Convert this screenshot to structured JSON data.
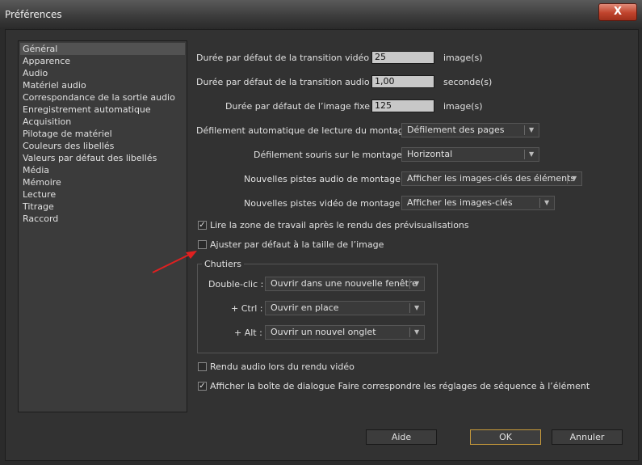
{
  "window": {
    "title": "Préférences",
    "close_label": "X"
  },
  "sidebar": {
    "items": [
      {
        "label": "Général",
        "selected": true
      },
      {
        "label": "Apparence"
      },
      {
        "label": "Audio"
      },
      {
        "label": "Matériel audio"
      },
      {
        "label": "Correspondance de la sortie audio"
      },
      {
        "label": "Enregistrement automatique"
      },
      {
        "label": "Acquisition"
      },
      {
        "label": "Pilotage de matériel"
      },
      {
        "label": "Couleurs des libellés"
      },
      {
        "label": "Valeurs par défaut des libellés"
      },
      {
        "label": "Média"
      },
      {
        "label": "Mémoire"
      },
      {
        "label": "Lecture"
      },
      {
        "label": "Titrage"
      },
      {
        "label": "Raccord"
      }
    ]
  },
  "fields": {
    "video_transition": {
      "label": "Durée par défaut de la transition vidéo :",
      "value": "25",
      "unit": "image(s)"
    },
    "audio_transition": {
      "label": "Durée par défaut de la transition audio :",
      "value": "1,00",
      "unit": "seconde(s)"
    },
    "still_image": {
      "label": "Durée par défaut de l’image fixe :",
      "value": "125",
      "unit": "image(s)"
    }
  },
  "dropdowns": {
    "auto_scroll": {
      "label": "Défilement automatique de lecture du montage :",
      "value": "Défilement des pages"
    },
    "mouse_scroll": {
      "label": "Défilement souris sur le montage :",
      "value": "Horizontal"
    },
    "new_audio_tracks": {
      "label": "Nouvelles pistes audio de montage :",
      "value": "Afficher les images-clés des éléments"
    },
    "new_video_tracks": {
      "label": "Nouvelles pistes vidéo de montage :",
      "value": "Afficher les images-clés"
    }
  },
  "checkboxes": {
    "play_work_area": {
      "label": "Lire la zone de travail après le rendu des prévisualisations",
      "checked": true
    },
    "scale_to_frame": {
      "label": "Ajuster par défaut à la taille de l’image",
      "checked": false
    },
    "render_audio": {
      "label": "Rendu audio lors du rendu vidéo",
      "checked": false
    },
    "show_match_dialog": {
      "label": "Afficher la boîte de dialogue Faire correspondre les réglages de séquence à l’élément",
      "checked": true
    }
  },
  "bins": {
    "title": "Chutiers",
    "double_click": {
      "label": "Double-clic :",
      "value": "Ouvrir dans une nouvelle fenêtre"
    },
    "ctrl": {
      "label": "+ Ctrl :",
      "value": "Ouvrir en place"
    },
    "alt": {
      "label": "+ Alt :",
      "value": "Ouvrir un nouvel onglet"
    }
  },
  "buttons": {
    "help": "Aide",
    "ok": "OK",
    "cancel": "Annuler"
  },
  "icons": {
    "check": "✓",
    "dropdown": "▼",
    "annotation_arrow_color": "#e02020"
  }
}
